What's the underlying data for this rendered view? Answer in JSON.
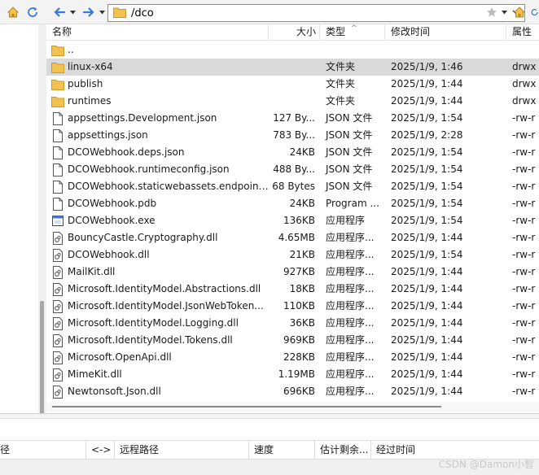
{
  "toolbar": {
    "path": "/dco"
  },
  "columns": {
    "name": "名称",
    "size": "大小",
    "type": "类型",
    "modified": "修改时间",
    "attributes": "属性"
  },
  "files": [
    {
      "name": "..",
      "size": "",
      "type": "",
      "modified": "",
      "attr": "",
      "icon": "folder-icon",
      "selected": false
    },
    {
      "name": "linux-x64",
      "size": "",
      "type": "文件夹",
      "modified": "2025/1/9, 1:46",
      "attr": "drwx",
      "icon": "folder-icon",
      "selected": true
    },
    {
      "name": "publish",
      "size": "",
      "type": "文件夹",
      "modified": "2025/1/9, 1:44",
      "attr": "drwx",
      "icon": "folder-icon",
      "selected": false
    },
    {
      "name": "runtimes",
      "size": "",
      "type": "文件夹",
      "modified": "2025/1/9, 1:44",
      "attr": "drwx",
      "icon": "folder-icon",
      "selected": false
    },
    {
      "name": "appsettings.Development.json",
      "size": "127 By...",
      "type": "JSON 文件",
      "modified": "2025/1/9, 1:54",
      "attr": "-rw-r",
      "icon": "file-icon",
      "selected": false
    },
    {
      "name": "appsettings.json",
      "size": "783 By...",
      "type": "JSON 文件",
      "modified": "2025/1/9, 2:28",
      "attr": "-rw-r",
      "icon": "file-icon",
      "selected": false
    },
    {
      "name": "DCOWebhook.deps.json",
      "size": "24KB",
      "type": "JSON 文件",
      "modified": "2025/1/9, 1:54",
      "attr": "-rw-r",
      "icon": "file-icon",
      "selected": false
    },
    {
      "name": "DCOWebhook.runtimeconfig.json",
      "size": "488 By...",
      "type": "JSON 文件",
      "modified": "2025/1/9, 1:54",
      "attr": "-rw-r",
      "icon": "file-icon",
      "selected": false
    },
    {
      "name": "DCOWebhook.staticwebassets.endpoint...",
      "size": "68 Bytes",
      "type": "JSON 文件",
      "modified": "2025/1/9, 1:54",
      "attr": "-rw-r",
      "icon": "file-icon",
      "selected": false
    },
    {
      "name": "DCOWebhook.pdb",
      "size": "24KB",
      "type": "Program ...",
      "modified": "2025/1/9, 1:54",
      "attr": "-rw-r",
      "icon": "file-icon",
      "selected": false
    },
    {
      "name": "DCOWebhook.exe",
      "size": "136KB",
      "type": "应用程序",
      "modified": "2025/1/9, 1:54",
      "attr": "-rw-r",
      "icon": "exe-icon",
      "selected": false
    },
    {
      "name": "BouncyCastle.Cryptography.dll",
      "size": "4.65MB",
      "type": "应用程序...",
      "modified": "2025/1/9, 1:44",
      "attr": "-rw-r",
      "icon": "dll-icon",
      "selected": false
    },
    {
      "name": "DCOWebhook.dll",
      "size": "21KB",
      "type": "应用程序...",
      "modified": "2025/1/9, 1:54",
      "attr": "-rw-r",
      "icon": "dll-icon",
      "selected": false
    },
    {
      "name": "MailKit.dll",
      "size": "927KB",
      "type": "应用程序...",
      "modified": "2025/1/9, 1:44",
      "attr": "-rw-r",
      "icon": "dll-icon",
      "selected": false
    },
    {
      "name": "Microsoft.IdentityModel.Abstractions.dll",
      "size": "18KB",
      "type": "应用程序...",
      "modified": "2025/1/9, 1:44",
      "attr": "-rw-r",
      "icon": "dll-icon",
      "selected": false
    },
    {
      "name": "Microsoft.IdentityModel.JsonWebToken...",
      "size": "110KB",
      "type": "应用程序...",
      "modified": "2025/1/9, 1:44",
      "attr": "-rw-r",
      "icon": "dll-icon",
      "selected": false
    },
    {
      "name": "Microsoft.IdentityModel.Logging.dll",
      "size": "36KB",
      "type": "应用程序...",
      "modified": "2025/1/9, 1:44",
      "attr": "-rw-r",
      "icon": "dll-icon",
      "selected": false
    },
    {
      "name": "Microsoft.IdentityModel.Tokens.dll",
      "size": "969KB",
      "type": "应用程序...",
      "modified": "2025/1/9, 1:44",
      "attr": "-rw-r",
      "icon": "dll-icon",
      "selected": false
    },
    {
      "name": "Microsoft.OpenApi.dll",
      "size": "228KB",
      "type": "应用程序...",
      "modified": "2025/1/9, 1:44",
      "attr": "-rw-r",
      "icon": "dll-icon",
      "selected": false
    },
    {
      "name": "MimeKit.dll",
      "size": "1.19MB",
      "type": "应用程序...",
      "modified": "2025/1/9, 1:44",
      "attr": "-rw-r",
      "icon": "dll-icon",
      "selected": false
    },
    {
      "name": "Newtonsoft.Json.dll",
      "size": "696KB",
      "type": "应用程序...",
      "modified": "2025/1/9, 1:44",
      "attr": "-rw-r",
      "icon": "dll-icon",
      "selected": false
    }
  ],
  "transfer_columns": {
    "local_path": "径",
    "direction": "<->",
    "remote_path": "远程路径",
    "speed": "速度",
    "remaining": "估计剩余...",
    "elapsed": "经过时间"
  },
  "watermark": "CSDN @Damon小智",
  "colors": {
    "folder": "#f2c14e",
    "selected_row": "#d9d9d9",
    "nav_arrow": "#3a7bd5"
  }
}
